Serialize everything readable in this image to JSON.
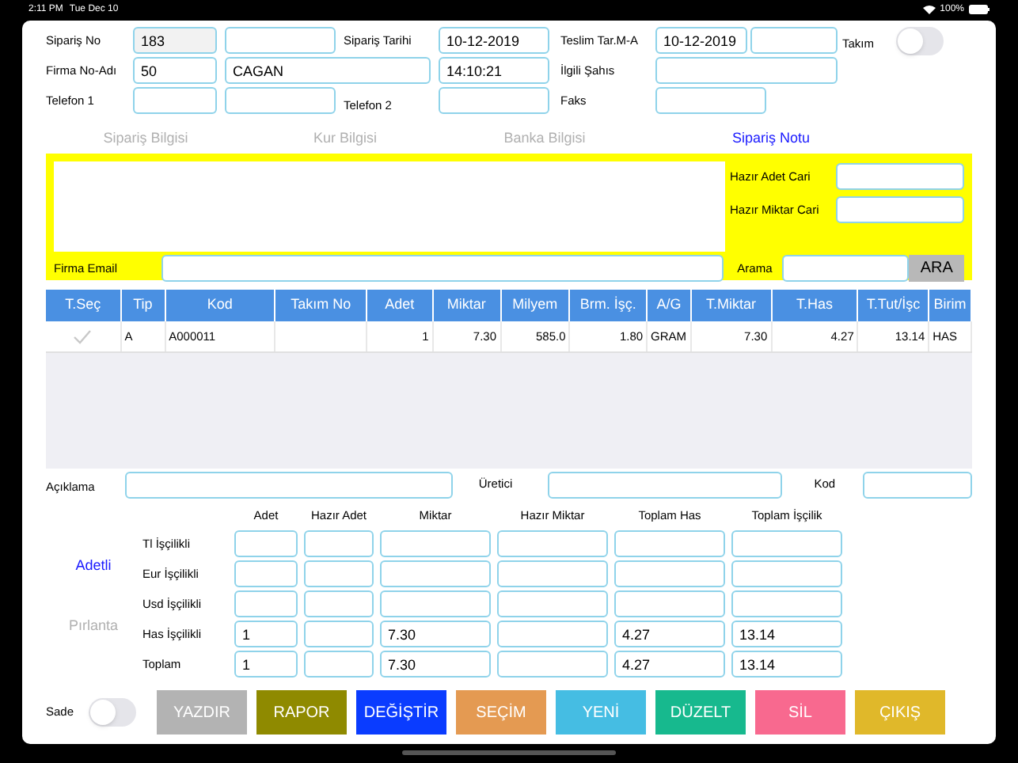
{
  "status_bar": {
    "time": "2:11 PM",
    "date": "Tue Dec 10",
    "battery": "100%"
  },
  "top_form": {
    "siparis_no": {
      "label": "Sipariş No",
      "value": "183",
      "disabled": true
    },
    "siparis_tarihi": {
      "label": "Sipariş Tarihi",
      "value": "10-12-2019"
    },
    "teslim_tarihi": {
      "label": "Teslim Tar.M-A",
      "value": "10-12-2019"
    },
    "takim": {
      "label": "Takım",
      "on": false
    },
    "firma": {
      "label": "Firma No-Adı",
      "no": "50",
      "name": "CAGAN"
    },
    "saat": {
      "value": "14:10:21"
    },
    "ilgili_sahis": {
      "label": "İlgili Şahıs"
    },
    "telefon_1": {
      "label": "Telefon 1"
    },
    "telefon_2": {
      "label": "Telefon 2"
    },
    "faks": {
      "label": "Faks"
    }
  },
  "tabs": [
    {
      "label": "Sipariş Bilgisi",
      "selected": false
    },
    {
      "label": "Kur Bilgisi",
      "selected": false
    },
    {
      "label": "Banka Bilgisi",
      "selected": false
    },
    {
      "label": "Sipariş Notu",
      "selected": true
    }
  ],
  "note_panel": {
    "hazir_adet_cari": {
      "label": "Hazır Adet Cari"
    },
    "hazir_miktar_cari": {
      "label": "Hazır Miktar Cari"
    },
    "firma_email": {
      "label": "Firma Email"
    },
    "arama": {
      "label": "Arama"
    },
    "search_button": "ARA"
  },
  "table": {
    "columns": [
      "T.Seç",
      "Tip",
      "Kod",
      "Takım No",
      "Adet",
      "Miktar",
      "Milyem",
      "Brm. İşç.",
      "A/G",
      "T.Miktar",
      "T.Has",
      "T.Tut/İşc",
      "Birim"
    ],
    "rows": [
      {
        "checked": true,
        "tip": "A",
        "kod": "A000011",
        "adet": "1",
        "miktar": "7.30",
        "milyem": "585.0",
        "brm_isc": "1.80",
        "ag": "GRAM",
        "t_miktar": "7.30",
        "t_has": "4.27",
        "t_tut_isc": "13.14",
        "birim": "HAS"
      }
    ]
  },
  "details": {
    "aciklama": "Açıklama",
    "uretici": "Üretici",
    "kod": "Kod"
  },
  "modes": [
    {
      "label": "Adetli",
      "selected": true
    },
    {
      "label": "Pırlanta",
      "selected": false
    }
  ],
  "totals": {
    "columns": [
      "Adet",
      "Hazır Adet",
      "Miktar",
      "Hazır Miktar",
      "Toplam Has",
      "Toplam İşçilik"
    ],
    "rows": [
      {
        "label": "Tl İşçilikli"
      },
      {
        "label": "Eur İşçilikli"
      },
      {
        "label": "Usd İşçilikli"
      },
      {
        "label": "Has İşçilikli",
        "adet": "1",
        "miktar": "7.30",
        "toplam_has": "4.27",
        "toplam_iscilik": "13.14"
      },
      {
        "label": "Toplam",
        "adet": "1",
        "miktar": "7.30",
        "toplam_has": "4.27",
        "toplam_iscilik": "13.14"
      }
    ]
  },
  "sade": {
    "label": "Sade",
    "on": false
  },
  "buttons": [
    {
      "label": "YAZDIR",
      "color": "#b3b3b3"
    },
    {
      "label": "RAPOR",
      "color": "#8f8a00"
    },
    {
      "label": "DEĞİŞTİR",
      "color": "#0a3cff"
    },
    {
      "label": "SEÇİM",
      "color": "#e49a52"
    },
    {
      "label": "YENİ",
      "color": "#45bde3"
    },
    {
      "label": "DÜZELT",
      "color": "#17b98e"
    },
    {
      "label": "SİL",
      "color": "#f8698f"
    },
    {
      "label": "ÇIKIŞ",
      "color": "#e0b82a"
    }
  ]
}
